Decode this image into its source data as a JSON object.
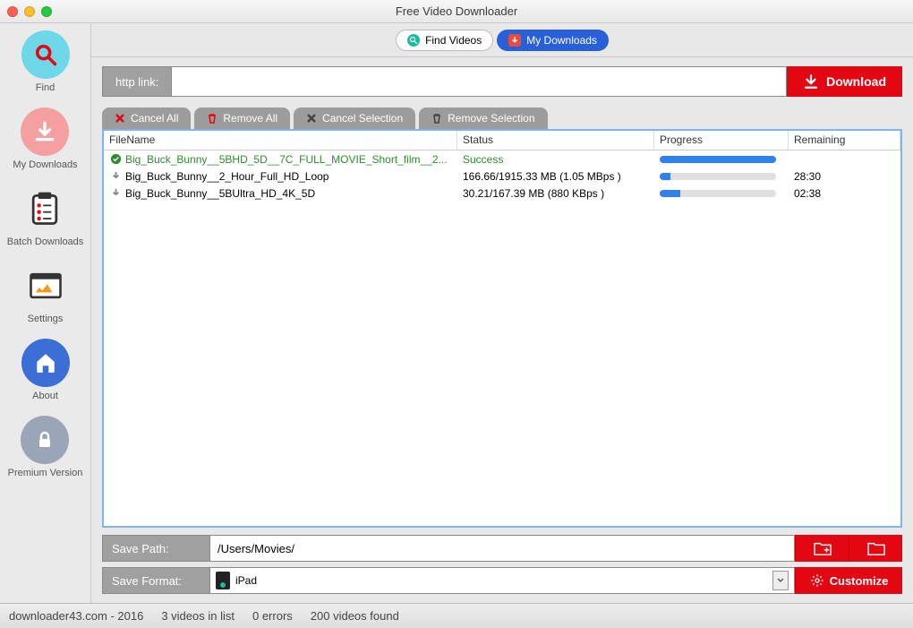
{
  "window": {
    "title": "Free Video Downloader"
  },
  "sidebar": {
    "items": [
      {
        "label": "Find"
      },
      {
        "label": "My Downloads"
      },
      {
        "label": "Batch Downloads"
      },
      {
        "label": "Settings"
      },
      {
        "label": "About"
      },
      {
        "label": "Premium Version"
      }
    ]
  },
  "tabs": {
    "find": "Find Videos",
    "downloads": "My Downloads"
  },
  "url": {
    "label": "http link:",
    "value": "",
    "button": "Download"
  },
  "actions": {
    "cancel_all": "Cancel All",
    "remove_all": "Remove All",
    "cancel_sel": "Cancel Selection",
    "remove_sel": "Remove Selection"
  },
  "table": {
    "headers": {
      "file": "FileName",
      "status": "Status",
      "progress": "Progress",
      "remaining": "Remaining"
    },
    "rows": [
      {
        "icon": "success",
        "file": "Big_Buck_Bunny__5BHD_5D__7C_FULL_MOVIE_Short_film__2...",
        "status": "Success",
        "progress": 100,
        "remaining": ""
      },
      {
        "icon": "download",
        "file": "Big_Buck_Bunny__2_Hour_Full_HD_Loop",
        "status": "166.66/1915.33 MB (1.05 MBps )",
        "progress": 9,
        "remaining": "28:30"
      },
      {
        "icon": "download",
        "file": "Big_Buck_Bunny__5BUltra_HD_4K_5D",
        "status": "30.21/167.39 MB (880 KBps )",
        "progress": 18,
        "remaining": "02:38"
      }
    ]
  },
  "save_path": {
    "label": "Save Path:",
    "value": "/Users/Movies/"
  },
  "save_format": {
    "label": "Save Format:",
    "value": "iPad",
    "button": "Customize"
  },
  "statusbar": {
    "brand": "downloader43.com - 2016",
    "videos": "3 videos in list",
    "errors": "0 errors",
    "found": "200 videos found"
  }
}
